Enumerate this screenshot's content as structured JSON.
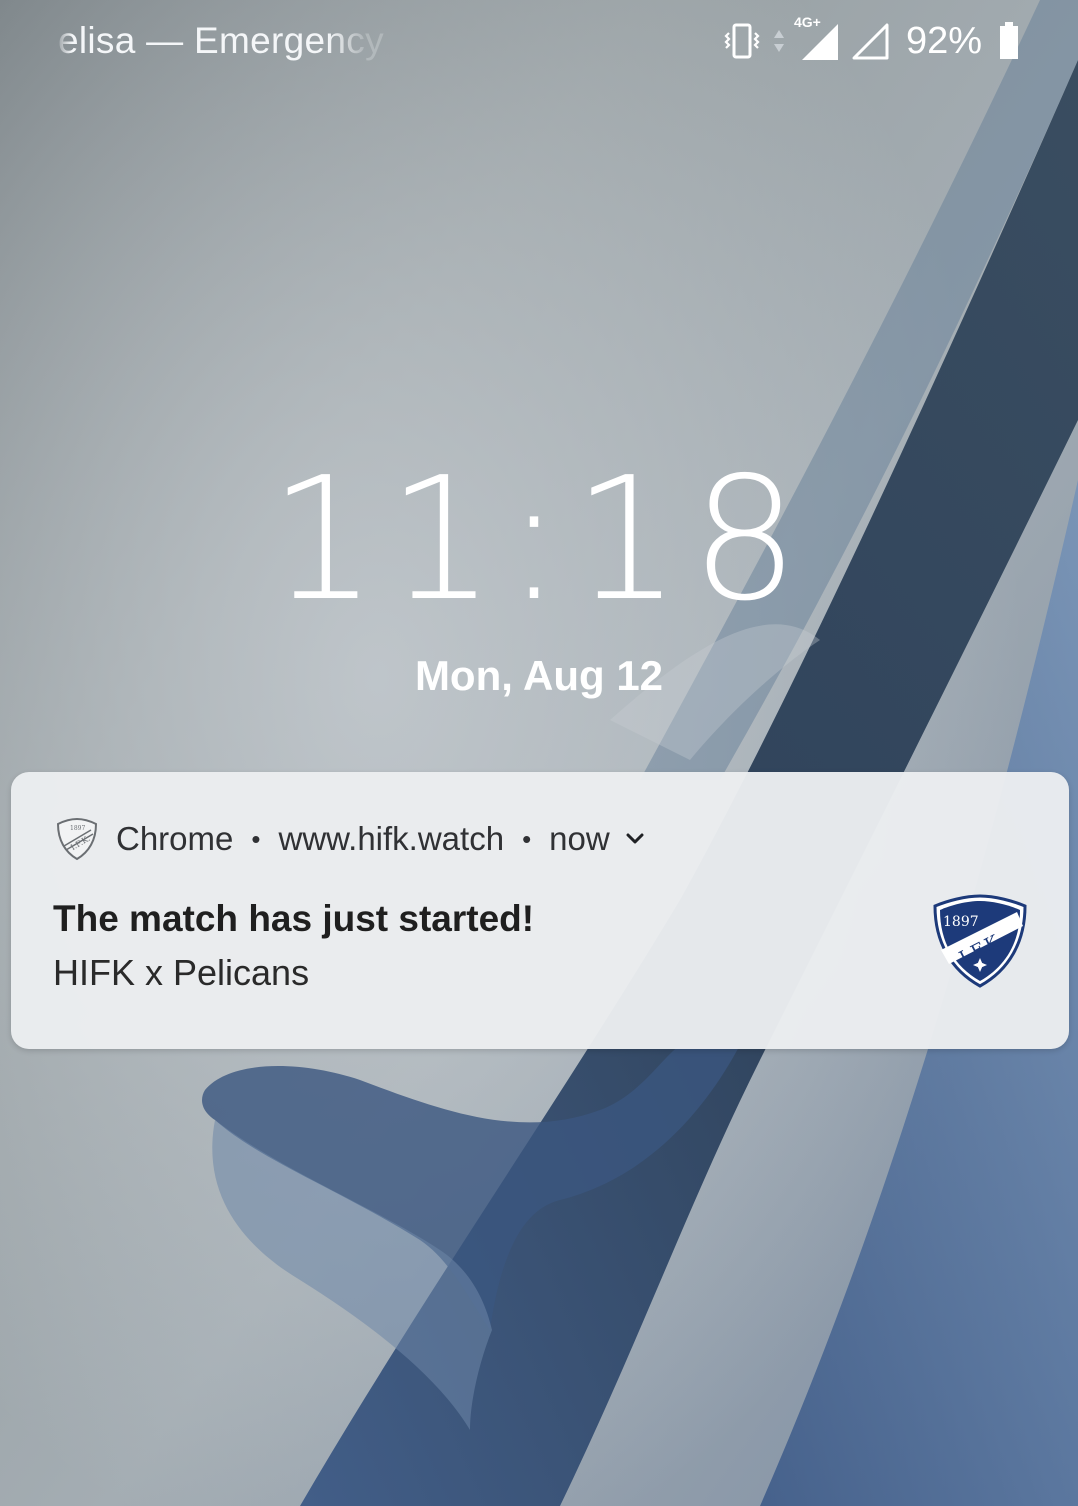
{
  "status_bar": {
    "carrier": "elisa — Emergency",
    "network_type": "4G+",
    "battery_percent": "92%",
    "icons": [
      "vibrate-icon",
      "data-activity-icon",
      "signal-4g-icon",
      "signal-empty-icon",
      "battery-icon"
    ]
  },
  "lockscreen": {
    "time": "11:18",
    "date": "Mon, Aug 12"
  },
  "notification": {
    "app": "Chrome",
    "source": "www.hifk.watch",
    "time": "now",
    "title": "The match has just started!",
    "text": "HIFK x Pelicans",
    "crest": {
      "year": "1897",
      "letters": "I.F.K."
    },
    "colors": {
      "crest_blue": "#1d3a7a",
      "background": "#ebedf0"
    }
  }
}
